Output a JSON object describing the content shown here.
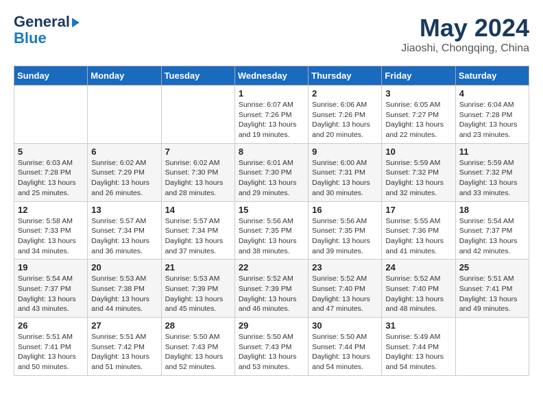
{
  "logo": {
    "line1": "General",
    "line2": "Blue"
  },
  "title": "May 2024",
  "location": "Jiaoshi, Chongqing, China",
  "days_of_week": [
    "Sunday",
    "Monday",
    "Tuesday",
    "Wednesday",
    "Thursday",
    "Friday",
    "Saturday"
  ],
  "weeks": [
    [
      {
        "day": "",
        "detail": ""
      },
      {
        "day": "",
        "detail": ""
      },
      {
        "day": "",
        "detail": ""
      },
      {
        "day": "1",
        "detail": "Sunrise: 6:07 AM\nSunset: 7:26 PM\nDaylight: 13 hours\nand 19 minutes."
      },
      {
        "day": "2",
        "detail": "Sunrise: 6:06 AM\nSunset: 7:26 PM\nDaylight: 13 hours\nand 20 minutes."
      },
      {
        "day": "3",
        "detail": "Sunrise: 6:05 AM\nSunset: 7:27 PM\nDaylight: 13 hours\nand 22 minutes."
      },
      {
        "day": "4",
        "detail": "Sunrise: 6:04 AM\nSunset: 7:28 PM\nDaylight: 13 hours\nand 23 minutes."
      }
    ],
    [
      {
        "day": "5",
        "detail": "Sunrise: 6:03 AM\nSunset: 7:28 PM\nDaylight: 13 hours\nand 25 minutes."
      },
      {
        "day": "6",
        "detail": "Sunrise: 6:02 AM\nSunset: 7:29 PM\nDaylight: 13 hours\nand 26 minutes."
      },
      {
        "day": "7",
        "detail": "Sunrise: 6:02 AM\nSunset: 7:30 PM\nDaylight: 13 hours\nand 28 minutes."
      },
      {
        "day": "8",
        "detail": "Sunrise: 6:01 AM\nSunset: 7:30 PM\nDaylight: 13 hours\nand 29 minutes."
      },
      {
        "day": "9",
        "detail": "Sunrise: 6:00 AM\nSunset: 7:31 PM\nDaylight: 13 hours\nand 30 minutes."
      },
      {
        "day": "10",
        "detail": "Sunrise: 5:59 AM\nSunset: 7:32 PM\nDaylight: 13 hours\nand 32 minutes."
      },
      {
        "day": "11",
        "detail": "Sunrise: 5:59 AM\nSunset: 7:32 PM\nDaylight: 13 hours\nand 33 minutes."
      }
    ],
    [
      {
        "day": "12",
        "detail": "Sunrise: 5:58 AM\nSunset: 7:33 PM\nDaylight: 13 hours\nand 34 minutes."
      },
      {
        "day": "13",
        "detail": "Sunrise: 5:57 AM\nSunset: 7:34 PM\nDaylight: 13 hours\nand 36 minutes."
      },
      {
        "day": "14",
        "detail": "Sunrise: 5:57 AM\nSunset: 7:34 PM\nDaylight: 13 hours\nand 37 minutes."
      },
      {
        "day": "15",
        "detail": "Sunrise: 5:56 AM\nSunset: 7:35 PM\nDaylight: 13 hours\nand 38 minutes."
      },
      {
        "day": "16",
        "detail": "Sunrise: 5:56 AM\nSunset: 7:35 PM\nDaylight: 13 hours\nand 39 minutes."
      },
      {
        "day": "17",
        "detail": "Sunrise: 5:55 AM\nSunset: 7:36 PM\nDaylight: 13 hours\nand 41 minutes."
      },
      {
        "day": "18",
        "detail": "Sunrise: 5:54 AM\nSunset: 7:37 PM\nDaylight: 13 hours\nand 42 minutes."
      }
    ],
    [
      {
        "day": "19",
        "detail": "Sunrise: 5:54 AM\nSunset: 7:37 PM\nDaylight: 13 hours\nand 43 minutes."
      },
      {
        "day": "20",
        "detail": "Sunrise: 5:53 AM\nSunset: 7:38 PM\nDaylight: 13 hours\nand 44 minutes."
      },
      {
        "day": "21",
        "detail": "Sunrise: 5:53 AM\nSunset: 7:39 PM\nDaylight: 13 hours\nand 45 minutes."
      },
      {
        "day": "22",
        "detail": "Sunrise: 5:52 AM\nSunset: 7:39 PM\nDaylight: 13 hours\nand 46 minutes."
      },
      {
        "day": "23",
        "detail": "Sunrise: 5:52 AM\nSunset: 7:40 PM\nDaylight: 13 hours\nand 47 minutes."
      },
      {
        "day": "24",
        "detail": "Sunrise: 5:52 AM\nSunset: 7:40 PM\nDaylight: 13 hours\nand 48 minutes."
      },
      {
        "day": "25",
        "detail": "Sunrise: 5:51 AM\nSunset: 7:41 PM\nDaylight: 13 hours\nand 49 minutes."
      }
    ],
    [
      {
        "day": "26",
        "detail": "Sunrise: 5:51 AM\nSunset: 7:41 PM\nDaylight: 13 hours\nand 50 minutes."
      },
      {
        "day": "27",
        "detail": "Sunrise: 5:51 AM\nSunset: 7:42 PM\nDaylight: 13 hours\nand 51 minutes."
      },
      {
        "day": "28",
        "detail": "Sunrise: 5:50 AM\nSunset: 7:43 PM\nDaylight: 13 hours\nand 52 minutes."
      },
      {
        "day": "29",
        "detail": "Sunrise: 5:50 AM\nSunset: 7:43 PM\nDaylight: 13 hours\nand 53 minutes."
      },
      {
        "day": "30",
        "detail": "Sunrise: 5:50 AM\nSunset: 7:44 PM\nDaylight: 13 hours\nand 54 minutes."
      },
      {
        "day": "31",
        "detail": "Sunrise: 5:49 AM\nSunset: 7:44 PM\nDaylight: 13 hours\nand 54 minutes."
      },
      {
        "day": "",
        "detail": ""
      }
    ]
  ]
}
